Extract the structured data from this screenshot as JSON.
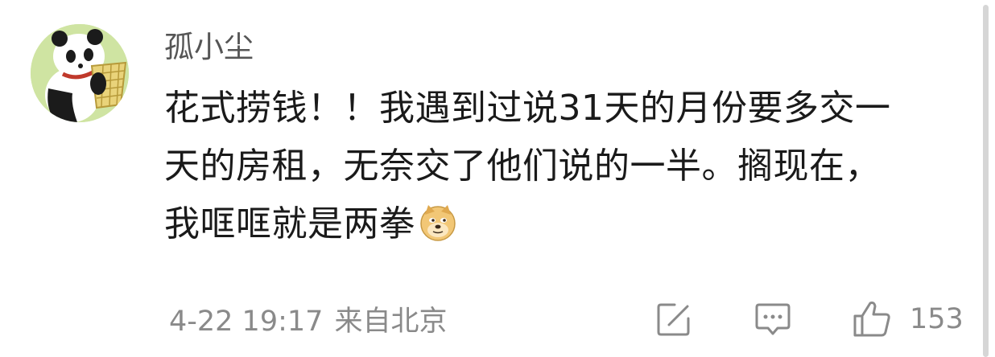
{
  "comment": {
    "username": "孤小尘",
    "text_lines": [
      "花式捞钱！！我遇到过说31天的月份要多交一",
      "天的房租，无奈交了他们说的一半。搁现在，",
      "我哐哐就是两拳"
    ],
    "emoji": "doge-emoji",
    "timestamp": "4-22 19:17",
    "location": "来自北京",
    "like_count": "153"
  },
  "icons": {
    "avatar": "panda-with-basket-avatar",
    "edit": "edit-square-icon",
    "comment": "comment-bubble-icon",
    "like": "thumbs-up-icon"
  },
  "colors": {
    "background": "#ffffff",
    "text": "#1a1a1a",
    "muted": "#8a8a8a",
    "username": "#555555"
  }
}
